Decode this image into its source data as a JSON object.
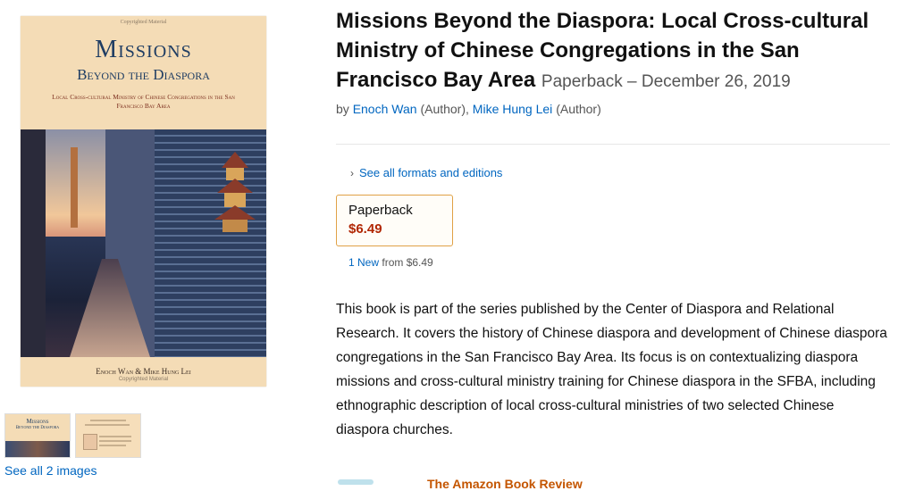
{
  "cover": {
    "copyright_top": "Copyrighted Material",
    "title_line1": "Missions",
    "title_line2": "Beyond the Diaspora",
    "subtitle": "Local Cross-cultural Ministry of Chinese Congregations in the San Francisco Bay Area",
    "authors": "Enoch Wan & Mike Hung Lei",
    "copyright_bottom": "Copyrighted Material"
  },
  "thumbnails": {
    "thumb1_title": "Missions",
    "thumb1_sub": "Beyond the Diaspora",
    "see_all": "See all 2 images"
  },
  "product": {
    "title": "Missions Beyond the Diaspora: Local Cross-cultural Ministry of Chinese Congregations in the San Francisco Bay Area",
    "format_date": "Paperback – December 26, 2019",
    "by": "by",
    "author1": "Enoch Wan",
    "author1_role": "(Author),",
    "author2": "Mike Hung Lei",
    "author2_role": "(Author)",
    "see_formats": "See all formats and editions",
    "format_label": "Paperback",
    "format_price": "$6.49",
    "new_count": "1 New",
    "new_from": "from $6.49",
    "description": "This book is part of the series published by the Center of Diaspora and Relational Research. It covers the history of Chinese diaspora and development of Chinese diaspora congregations in the San Francisco Bay Area. Its focus is on contextualizing diaspora missions and cross-cultural ministry training for Chinese diaspora in the SFBA, including ethnographic description of local cross-cultural ministries of two selected Chinese diaspora churches.",
    "review_heading": "The Amazon Book Review"
  },
  "colors": {
    "link": "#0066c0",
    "price": "#b12704",
    "selected_border": "#e0a146",
    "cover_bg": "#f4dcb6",
    "cover_title": "#1f3d63"
  },
  "icons": {
    "chevron": "chevron-right-icon"
  }
}
